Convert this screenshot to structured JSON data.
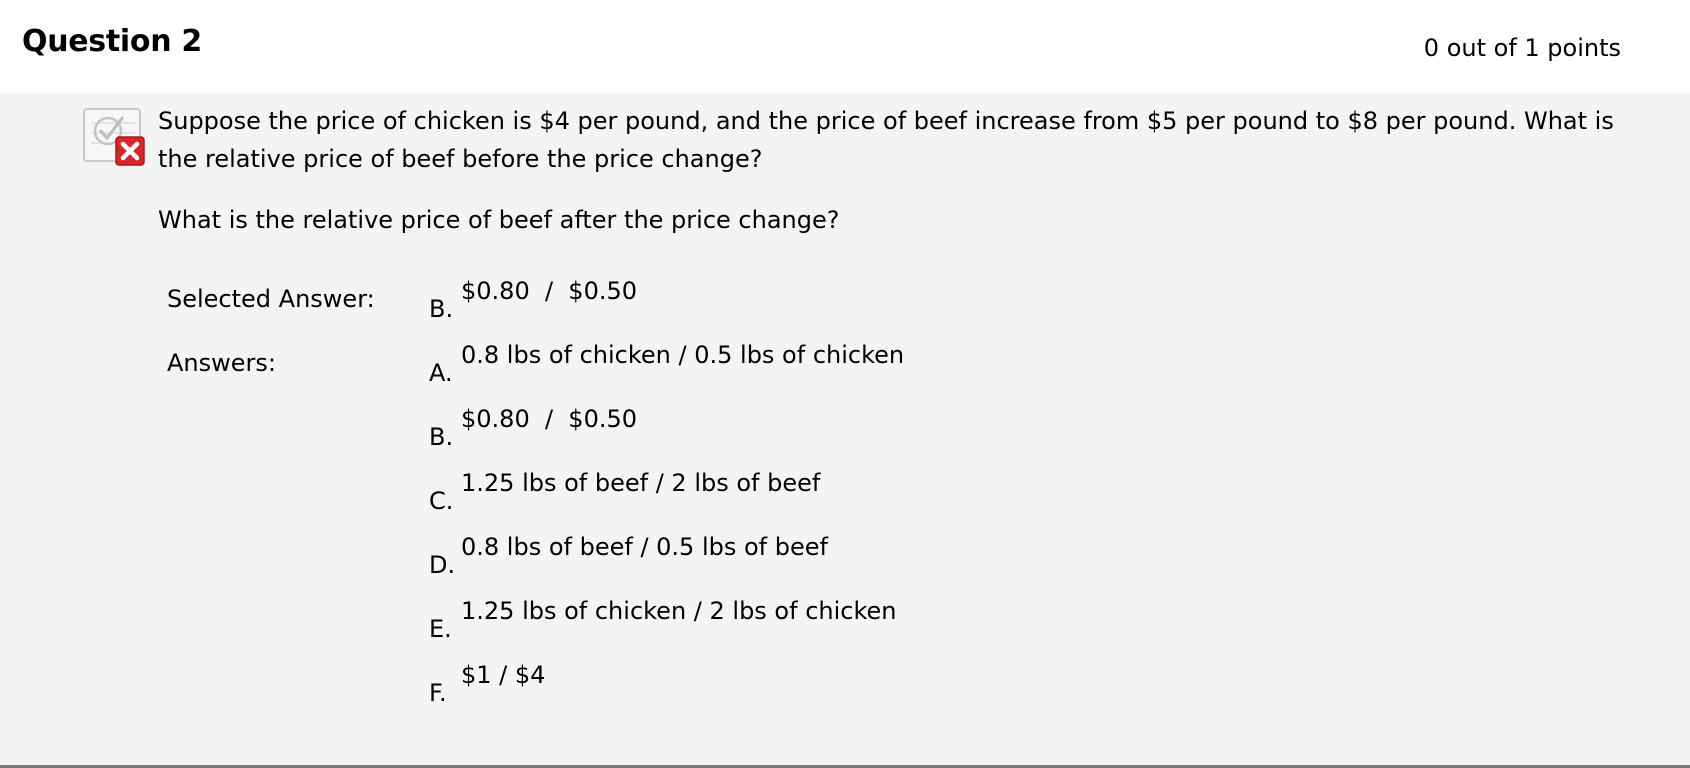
{
  "question": {
    "title": "Question 2",
    "score": "0 out of 1 points",
    "status_icon": "incorrect-x-icon",
    "text": "Suppose the price of chicken is $4 per pound, and the price of beef increase from $5 per pound to $8 per pound.  What is the relative price of beef before the price change?",
    "followup": "What is the relative price of beef after the price change?"
  },
  "selected": {
    "label": "Selected Answer:",
    "letter": "B.",
    "text": "$0.80  /  $0.50"
  },
  "answers": {
    "label": "Answers:",
    "items": [
      {
        "letter": "A.",
        "text": "0.8 lbs of chicken / 0.5 lbs of chicken"
      },
      {
        "letter": "B.",
        "text": "$0.80  /  $0.50"
      },
      {
        "letter": "C.",
        "text": "1.25 lbs of beef / 2 lbs of beef"
      },
      {
        "letter": "D.",
        "text": "0.8 lbs of beef / 0.5 lbs of beef"
      },
      {
        "letter": "E.",
        "text": "1.25 lbs of chicken / 2 lbs of chicken"
      },
      {
        "letter": "F.",
        "text": "$1 / $4"
      }
    ]
  },
  "colors": {
    "background": "#f4f4f4",
    "header_background": "#ffffff",
    "incorrect_red": "#d4262b",
    "divider": "#7a7a7a"
  }
}
